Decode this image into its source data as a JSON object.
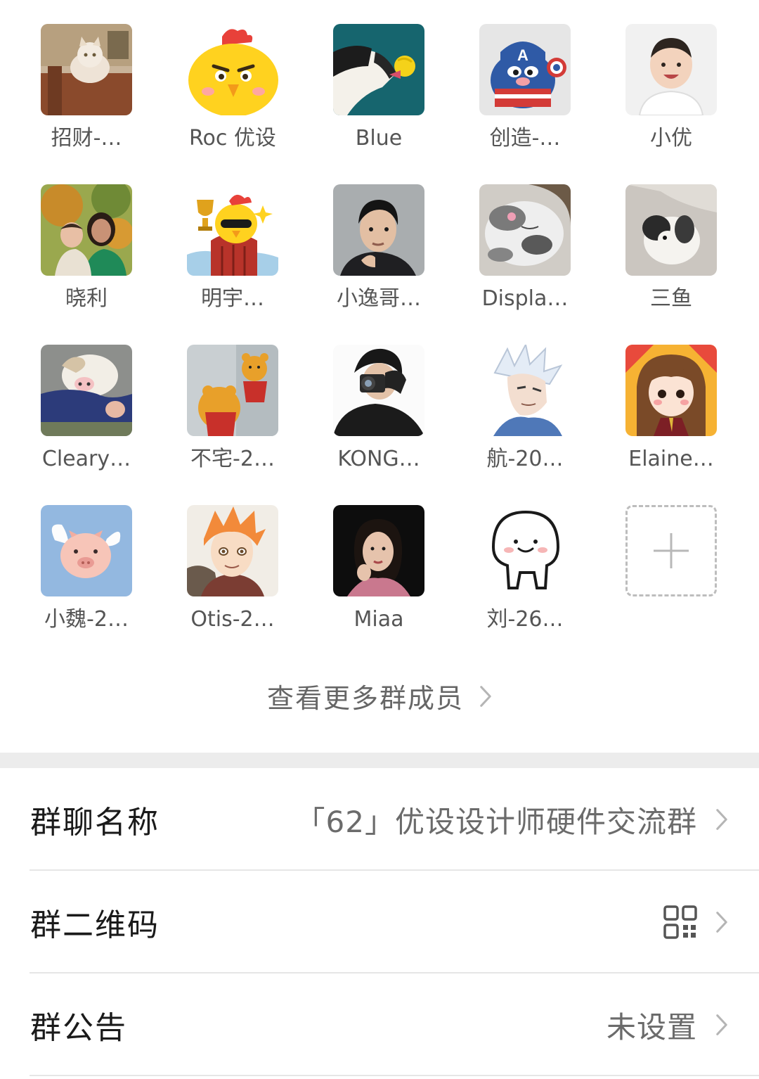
{
  "members": [
    {
      "name": "招财-…",
      "avatar": "cat-on-sofa-avatar"
    },
    {
      "name": "Roc 优设",
      "avatar": "angry-chick-avatar"
    },
    {
      "name": "Blue",
      "avatar": "dog-with-ball-avatar"
    },
    {
      "name": "创造-…",
      "avatar": "captain-america-avatar"
    },
    {
      "name": "小优",
      "avatar": "smiling-boy-avatar"
    },
    {
      "name": "晓利",
      "avatar": "mother-and-baby-avatar"
    },
    {
      "name": "明宇…",
      "avatar": "trophy-chick-avatar"
    },
    {
      "name": "小逸哥…",
      "avatar": "man-portrait-avatar"
    },
    {
      "name": "Displa…",
      "avatar": "sleeping-cat-avatar"
    },
    {
      "name": "三鱼",
      "avatar": "puppy-avatar"
    },
    {
      "name": "Cleary…",
      "avatar": "husky-avatar"
    },
    {
      "name": "不宅-2…",
      "avatar": "winnie-the-pooh-avatar"
    },
    {
      "name": "KONG…",
      "avatar": "camera-man-avatar"
    },
    {
      "name": "航-20…",
      "avatar": "anime-hero-avatar"
    },
    {
      "name": "Elaine…",
      "avatar": "cartoon-girl-avatar"
    },
    {
      "name": "小魏-2…",
      "avatar": "flying-pig-avatar"
    },
    {
      "name": "Otis-2…",
      "avatar": "anime-boy-avatar"
    },
    {
      "name": "Miaa",
      "avatar": "woman-portrait-avatar"
    },
    {
      "name": "刘-26…",
      "avatar": "cute-blob-avatar"
    }
  ],
  "add_member_icon": "plus-icon",
  "view_more": {
    "label": "查看更多群成员"
  },
  "settings": {
    "group_name": {
      "label": "群聊名称",
      "value": "「62」优设设计师硬件交流群"
    },
    "qr_code": {
      "label": "群二维码",
      "icon": "qr-code-icon"
    },
    "announcement": {
      "label": "群公告",
      "value": "未设置"
    }
  },
  "colors": {
    "background": "#ffffff",
    "section_divider": "#ececec",
    "primary_text": "#1a1a1a",
    "secondary_text": "#666666",
    "chevron": "#b5b5b5"
  }
}
